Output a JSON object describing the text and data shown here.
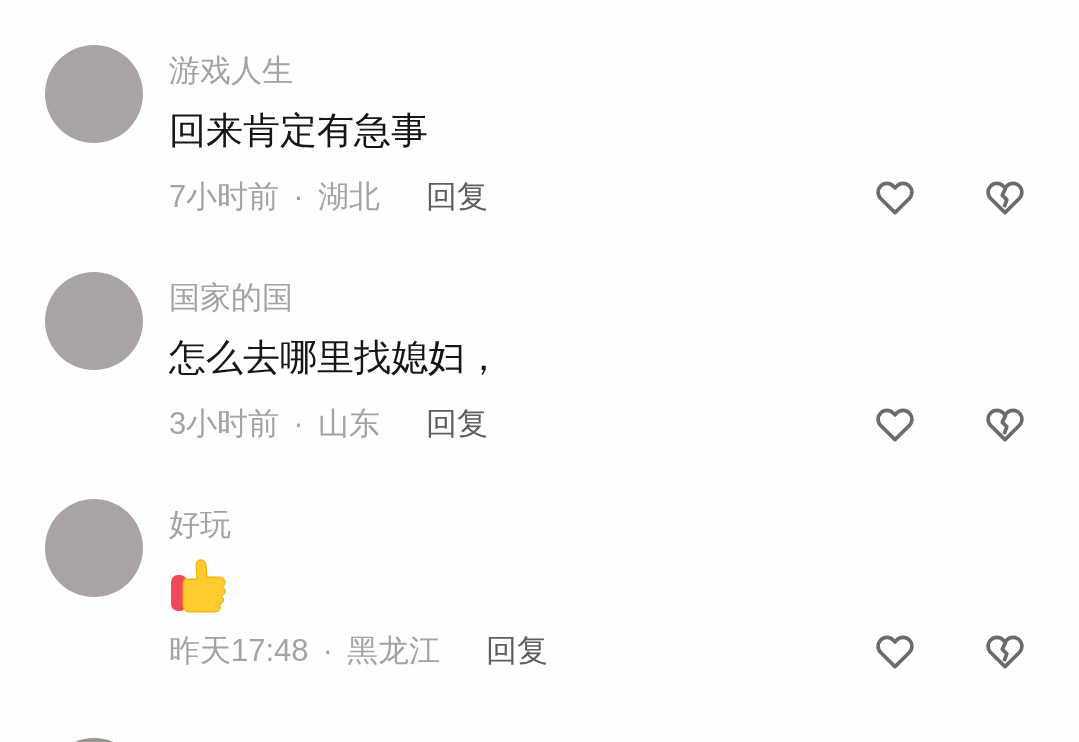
{
  "comments": [
    {
      "username": "游戏人生",
      "content": {
        "kind": "text",
        "text": "回来肯定有急事"
      },
      "time": "7小时前",
      "separator": "·",
      "location": "湖北",
      "reply": "回复",
      "liked": false,
      "disliked": false
    },
    {
      "username": "国家的国",
      "content": {
        "kind": "text",
        "text": "怎么去哪里找媳妇，"
      },
      "time": "3小时前",
      "separator": "·",
      "location": "山东",
      "reply": "回复",
      "liked": false,
      "disliked": false
    },
    {
      "username": "好玩",
      "content": {
        "kind": "sticker"
      },
      "time": "昨天17:48",
      "separator": "·",
      "location": "黑龙江",
      "reply": "回复",
      "liked": false,
      "disliked": false
    }
  ],
  "more_below": true
}
